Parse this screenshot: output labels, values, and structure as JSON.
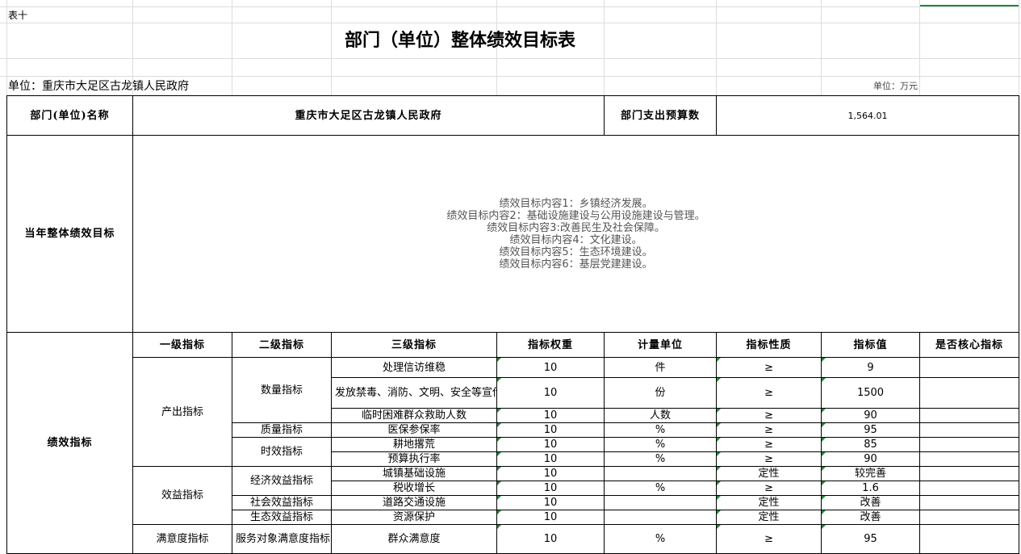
{
  "sheet": {
    "table_no": "表十",
    "title": "部门（单位）整体绩效目标表",
    "unit_left": "单位：重庆市大足区古龙镇人民政府",
    "unit_right": "单位：万元"
  },
  "info": {
    "dept_name_label": "部门(单位)名称",
    "dept_name_value": "重庆市大足区古龙镇人民政府",
    "budget_label": "部门支出预算数",
    "budget_value": "1,564.01",
    "goals_label": "当年整体绩效目标",
    "goals": [
      "绩效目标内容1：乡镇经济发展。",
      "绩效目标内容2：基础设施建设与公用设施建设与管理。",
      "绩效目标内容3:改善民生及社会保障。",
      "绩效目标内容4：文化建设。",
      "绩效目标内容5：生态环境建设。",
      "绩效目标内容6：基层党建建设。"
    ]
  },
  "indicators": {
    "section_label": "绩效指标",
    "headers": [
      "一级指标",
      "二级指标",
      "三级指标",
      "指标权重",
      "计量单位",
      "指标性质",
      "指标值",
      "是否核心指标"
    ],
    "level1": {
      "output": "产出指标",
      "benefit": "效益指标",
      "satisfaction": "满意度指标"
    },
    "level2": {
      "quantity": "数量指标",
      "quality": "质量指标",
      "timeliness": "时效指标",
      "economic": "经济效益指标",
      "social": "社会效益指标",
      "ecological": "生态效益指标",
      "service": "服务对象满意度指标"
    },
    "rows": [
      {
        "l3": "处理信访维稳",
        "weight": "10",
        "unit": "件",
        "nature": "≥",
        "value": "9"
      },
      {
        "l3": "发放禁毒、消防、文明、安全等宣传资料",
        "weight": "10",
        "unit": "份",
        "nature": "≥",
        "value": "1500"
      },
      {
        "l3": "临时困难群众救助人数",
        "weight": "10",
        "unit": "人数",
        "nature": "≥",
        "value": "90"
      },
      {
        "l3": "医保参保率",
        "weight": "10",
        "unit": "%",
        "nature": "≥",
        "value": "95"
      },
      {
        "l3": "耕地撂荒",
        "weight": "10",
        "unit": "%",
        "nature": "≥",
        "value": "85"
      },
      {
        "l3": "预算执行率",
        "weight": "10",
        "unit": "%",
        "nature": "≥",
        "value": "90"
      },
      {
        "l3": "城镇基础设施",
        "weight": "10",
        "unit": "",
        "nature": "定性",
        "value": "较完善"
      },
      {
        "l3": "税收增长",
        "weight": "10",
        "unit": "%",
        "nature": "≥",
        "value": "1.6"
      },
      {
        "l3": "道路交通设施",
        "weight": "10",
        "unit": "",
        "nature": "定性",
        "value": "改善"
      },
      {
        "l3": "资源保护",
        "weight": "10",
        "unit": "",
        "nature": "定性",
        "value": "改善"
      },
      {
        "l3": "群众满意度",
        "weight": "10",
        "unit": "%",
        "nature": "≥",
        "value": "95"
      }
    ]
  }
}
